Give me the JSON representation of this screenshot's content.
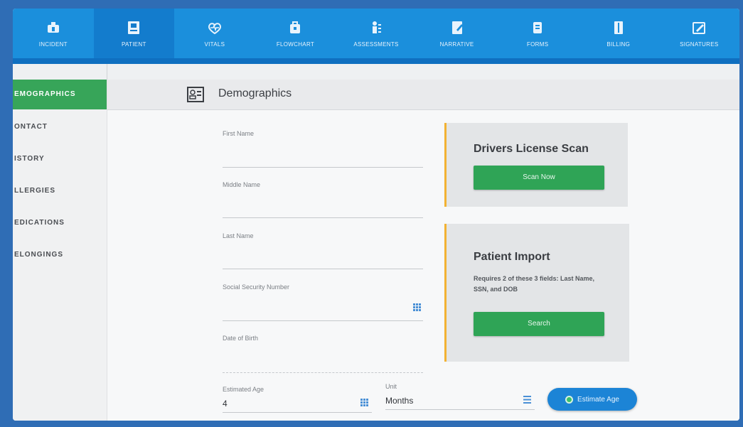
{
  "nav": {
    "items": [
      {
        "label": "INCIDENT",
        "icon": "incident-icon"
      },
      {
        "label": "PATIENT",
        "icon": "patient-icon"
      },
      {
        "label": "VITALS",
        "icon": "vitals-icon"
      },
      {
        "label": "FLOWCHART",
        "icon": "flowchart-icon"
      },
      {
        "label": "ASSESSMENTS",
        "icon": "assessments-icon"
      },
      {
        "label": "NARRATIVE",
        "icon": "narrative-icon"
      },
      {
        "label": "FORMS",
        "icon": "forms-icon"
      },
      {
        "label": "BILLING",
        "icon": "billing-icon"
      },
      {
        "label": "SIGNATURES",
        "icon": "signatures-icon"
      }
    ],
    "active": "PATIENT"
  },
  "sidebar": {
    "items": [
      {
        "label": "EMOGRAPHICS"
      },
      {
        "label": "ONTACT"
      },
      {
        "label": "ISTORY"
      },
      {
        "label": "LLERGIES"
      },
      {
        "label": "EDICATIONS"
      },
      {
        "label": "ELONGINGS"
      }
    ],
    "active": "EMOGRAPHICS"
  },
  "section": {
    "title": "Demographics",
    "icon": "id-card-icon"
  },
  "form": {
    "first_name_label": "First Name",
    "middle_name_label": "Middle Name",
    "last_name_label": "Last Name",
    "ssn_label": "Social Security Number",
    "dob_label": "Date of Birth",
    "est_age_label": "Estimated Age",
    "est_age_value": "4",
    "unit_label": "Unit",
    "unit_value": "Months",
    "estimate_button": "Estimate Age"
  },
  "license_card": {
    "title": "Drivers License Scan",
    "button": "Scan Now"
  },
  "import_card": {
    "title": "Patient Import",
    "note": "Requires 2 of these 3 fields: Last Name, SSN, and DOB",
    "button": "Search"
  },
  "colors": {
    "nav_bg": "#1b8fdc",
    "accent_green": "#2fa456",
    "card_accent": "#f2b233",
    "estimate_btn": "#1c84d6"
  }
}
